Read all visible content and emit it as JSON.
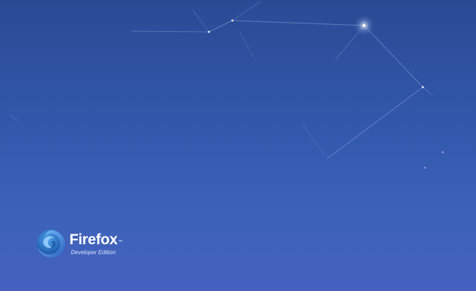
{
  "desktop": {
    "background_colors": [
      "#2a4a94",
      "#3358ac",
      "#3d62b9",
      "#4661c0"
    ],
    "brand": {
      "name": "Firefox",
      "trademark": "™",
      "edition": "Developer Edition",
      "logo_icon": "firefox-developer-edition-logo-icon",
      "accent_color": "#ffffff"
    }
  }
}
